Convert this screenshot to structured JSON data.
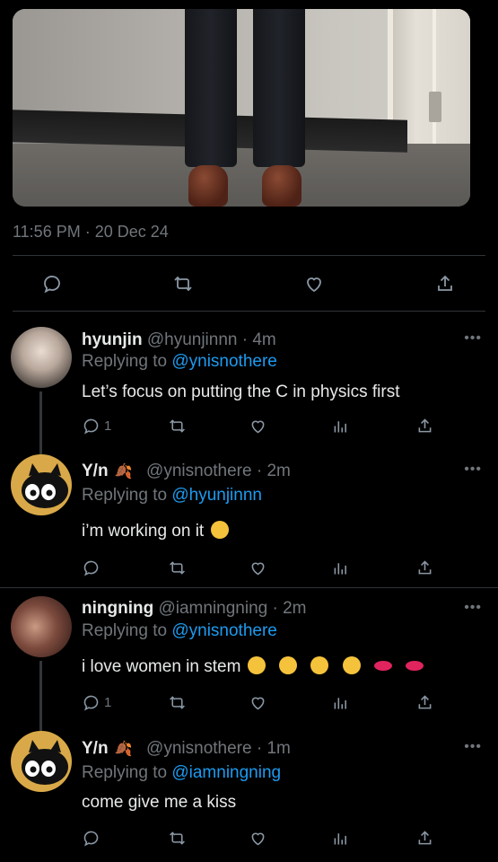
{
  "tweet": {
    "timestamp": "11:56 PM · 20 Dec 24",
    "actions": [
      "reply-icon",
      "retweet-icon",
      "like-icon",
      "share-icon"
    ]
  },
  "replies": [
    {
      "name": "hyunjin",
      "handle": "@hyunjinnn · 4m",
      "replying_prefix": "Replying to",
      "replying_to": "@ynisnothere",
      "text": "Let’s focus on putting the C in physics first",
      "reply_count": "1",
      "more": "•••"
    },
    {
      "name": "Y/n",
      "handle": "@ynisnothere · 2m",
      "replying_prefix": "Replying to",
      "replying_to": "@hyunjinnn",
      "text": "i’m working on it",
      "reply_count": "",
      "more": "•••"
    },
    {
      "name": "ningning",
      "handle": "@iamningning · 2m",
      "replying_prefix": "Replying to",
      "replying_to": "@ynisnothere",
      "text": "i love women in stem",
      "reply_count": "1",
      "more": "•••"
    },
    {
      "name": "Y/n",
      "handle": "@ynisnothere · 1m",
      "replying_prefix": "Replying to",
      "replying_to": "@iamningning",
      "text": "come give me a kiss",
      "reply_count": "",
      "more": "•••"
    }
  ],
  "colors": {
    "background": "#000000",
    "text": "#e7e9ea",
    "muted": "#71767b",
    "link": "#1d9bf0",
    "divider": "#2f3336"
  }
}
